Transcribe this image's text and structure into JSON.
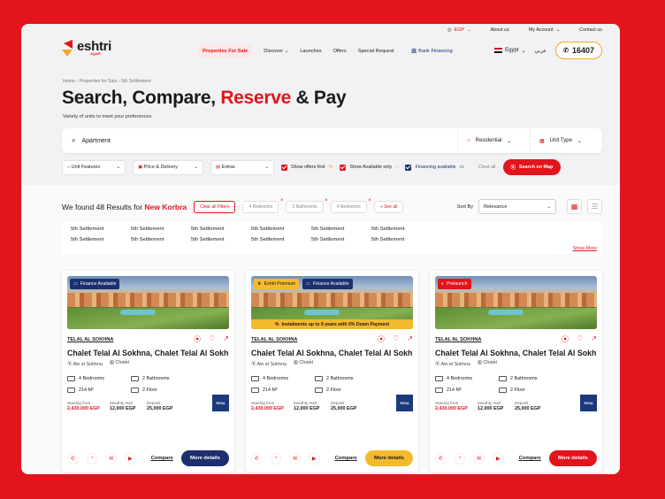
{
  "topbar": {
    "currency": "EGP",
    "about": "About us",
    "account": "My Account",
    "contact": "Contact us"
  },
  "brand": {
    "name": "eshtri",
    "sub": "AQAR"
  },
  "nav": {
    "items": [
      "Properties For Sale",
      "Discover",
      "Launches",
      "Offers",
      "Special Request",
      "Bank Financing"
    ],
    "country": "Egypt",
    "lang": "عربي",
    "hotline": "16407"
  },
  "breadcrumb": [
    "Home",
    "Properties for Sale",
    "5th Settlement"
  ],
  "hero": {
    "h1": "Search, Compare, ",
    "h2": "Reserve",
    "h3": " & Pay",
    "sub": "Variety of units to meet your preferences"
  },
  "search": {
    "query": "Apartment",
    "type": "Residential",
    "unit": "Unit Type"
  },
  "filters": {
    "features": "Unit Features",
    "price": "Price & Delivery",
    "extras": "Extras",
    "offers": "Show offers first",
    "available": "Show Available only",
    "financing": "Financing available",
    "clear": "Clear all",
    "map": "Search on Map"
  },
  "results": {
    "prefix": "We found 48 Results for ",
    "place": "New Korbra",
    "clear_filters": "Clear all Filters",
    "chips": [
      "4 Bedrooms",
      "2 Bathrooms",
      "4 Bedrooms"
    ],
    "see_all": "+ See all",
    "sort_label": "Sort By",
    "sort_value": "Relevance"
  },
  "areas": {
    "items": [
      "5th Settlement",
      "5th Settlement",
      "5th Settlement",
      "5th Settlement",
      "5th Settlement",
      "5th Settlement",
      "5th Settlement",
      "5th Settlement",
      "5th Settlement",
      "5th Settlement",
      "5th Settlement",
      "5th Settlement"
    ],
    "show_more": "Show More"
  },
  "cards": [
    {
      "badge1": "Finance Available",
      "compound": "TELAL AL SOKHNA",
      "name": "Chalet Telal Al Sokhna, Chalet Telal Al Sokhna",
      "location": "Ain el Sokhna",
      "kind": "Chalet",
      "beds": "4 Bedrooms",
      "baths": "2 Bathrooms",
      "area": "214 M²",
      "floor": "2 Floor",
      "dev": "RŌVA",
      "p_label": "Starting from",
      "p_val": "2,430,000 EGP",
      "m_label": "Monthly Instl",
      "m_val": "12,000 EGP",
      "d_label": "Deposit",
      "d_val": "25,000 EGP",
      "compare": "Compare",
      "more": "More details"
    },
    {
      "badge1": "Eshtri Premium",
      "badge2": "Finance Available",
      "banner": "Instalments up to 9 years with 0% Down Payment",
      "compound": "TELAL AL SOKHNA",
      "name": "Chalet Telal Al Sokhna, Chalet Telal Al Sokhna",
      "location": "Ain el Sokhna",
      "kind": "Chalet",
      "beds": "4 Bedrooms",
      "baths": "2 Bathrooms",
      "area": "214 M²",
      "floor": "2 Floor",
      "dev": "RŌVA",
      "p_label": "Starting from",
      "p_val": "2,430,000 EGP",
      "m_label": "Monthly Instl",
      "m_val": "12,000 EGP",
      "d_label": "Deposit",
      "d_val": "25,000 EGP",
      "compare": "Compare",
      "more": "More details"
    },
    {
      "badge1": "Prelaunch",
      "compound": "TELAL AL SOKHNA",
      "name": "Chalet Telal Al Sokhna, Chalet Telal Al Sokhna",
      "location": "Ain el Sokhna",
      "kind": "Chalet",
      "beds": "4 Bedrooms",
      "baths": "2 Bathrooms",
      "area": "214 M²",
      "floor": "2 Floor",
      "dev": "RŌVA",
      "p_label": "Starting from",
      "p_val": "2,430,000 EGP",
      "m_label": "Monthly Instl",
      "m_val": "12,000 EGP",
      "d_label": "Deposit",
      "d_val": "25,000 EGP",
      "compare": "Compare",
      "more": "More details"
    }
  ]
}
